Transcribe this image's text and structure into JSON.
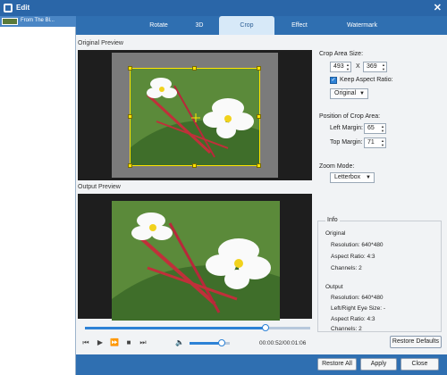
{
  "window": {
    "title": "Edit",
    "close_icon": "close-icon",
    "app_icon": "app-edit-icon"
  },
  "sidebar": {
    "items": [
      {
        "label": "From The Bl..."
      }
    ]
  },
  "tabs": [
    {
      "label": "Rotate"
    },
    {
      "label": "3D"
    },
    {
      "label": "Crop",
      "active": true
    },
    {
      "label": "Effect"
    },
    {
      "label": "Watermark"
    }
  ],
  "preview": {
    "original_label": "Original Preview",
    "output_label": "Output Preview"
  },
  "playback": {
    "progress": 0.8,
    "volume": 0.8,
    "time": "00:00:52/00:01:06",
    "icons": [
      "skip-start-icon",
      "play-icon",
      "fast-forward-icon",
      "stop-icon",
      "skip-end-icon",
      "volume-icon"
    ]
  },
  "crop": {
    "area_size_label": "Crop Area Size:",
    "width": "493",
    "separator": "X",
    "height": "369",
    "keep_aspect_label": "Keep Aspect Ratio:",
    "keep_aspect_checked": true,
    "aspect_option": "Original",
    "position_label": "Position of Crop Area:",
    "left_margin_label": "Left Margin:",
    "left_margin": "65",
    "top_margin_label": "Top Margin:",
    "top_margin": "71",
    "zoom_mode_label": "Zoom Mode:",
    "zoom_mode": "Letterbox"
  },
  "info": {
    "title": "Info",
    "original_heading": "Original",
    "original_resolution": "Resolution: 640*480",
    "original_aspect": "Aspect Ratio: 4:3",
    "original_channels": "Channels: 2",
    "output_heading": "Output",
    "output_resolution": "Resolution: 640*480",
    "output_eye_size": "Left/Right Eye Size: -",
    "output_aspect": "Aspect Ratio: 4:3",
    "output_channels": "Channels: 2"
  },
  "buttons": {
    "restore_defaults": "Restore Defaults",
    "restore_all": "Restore All",
    "apply": "Apply",
    "close": "Close"
  },
  "colors": {
    "accent": "#2f6fb1",
    "tab_active": "#d7e9f8",
    "crop_frame": "#ffe600"
  }
}
